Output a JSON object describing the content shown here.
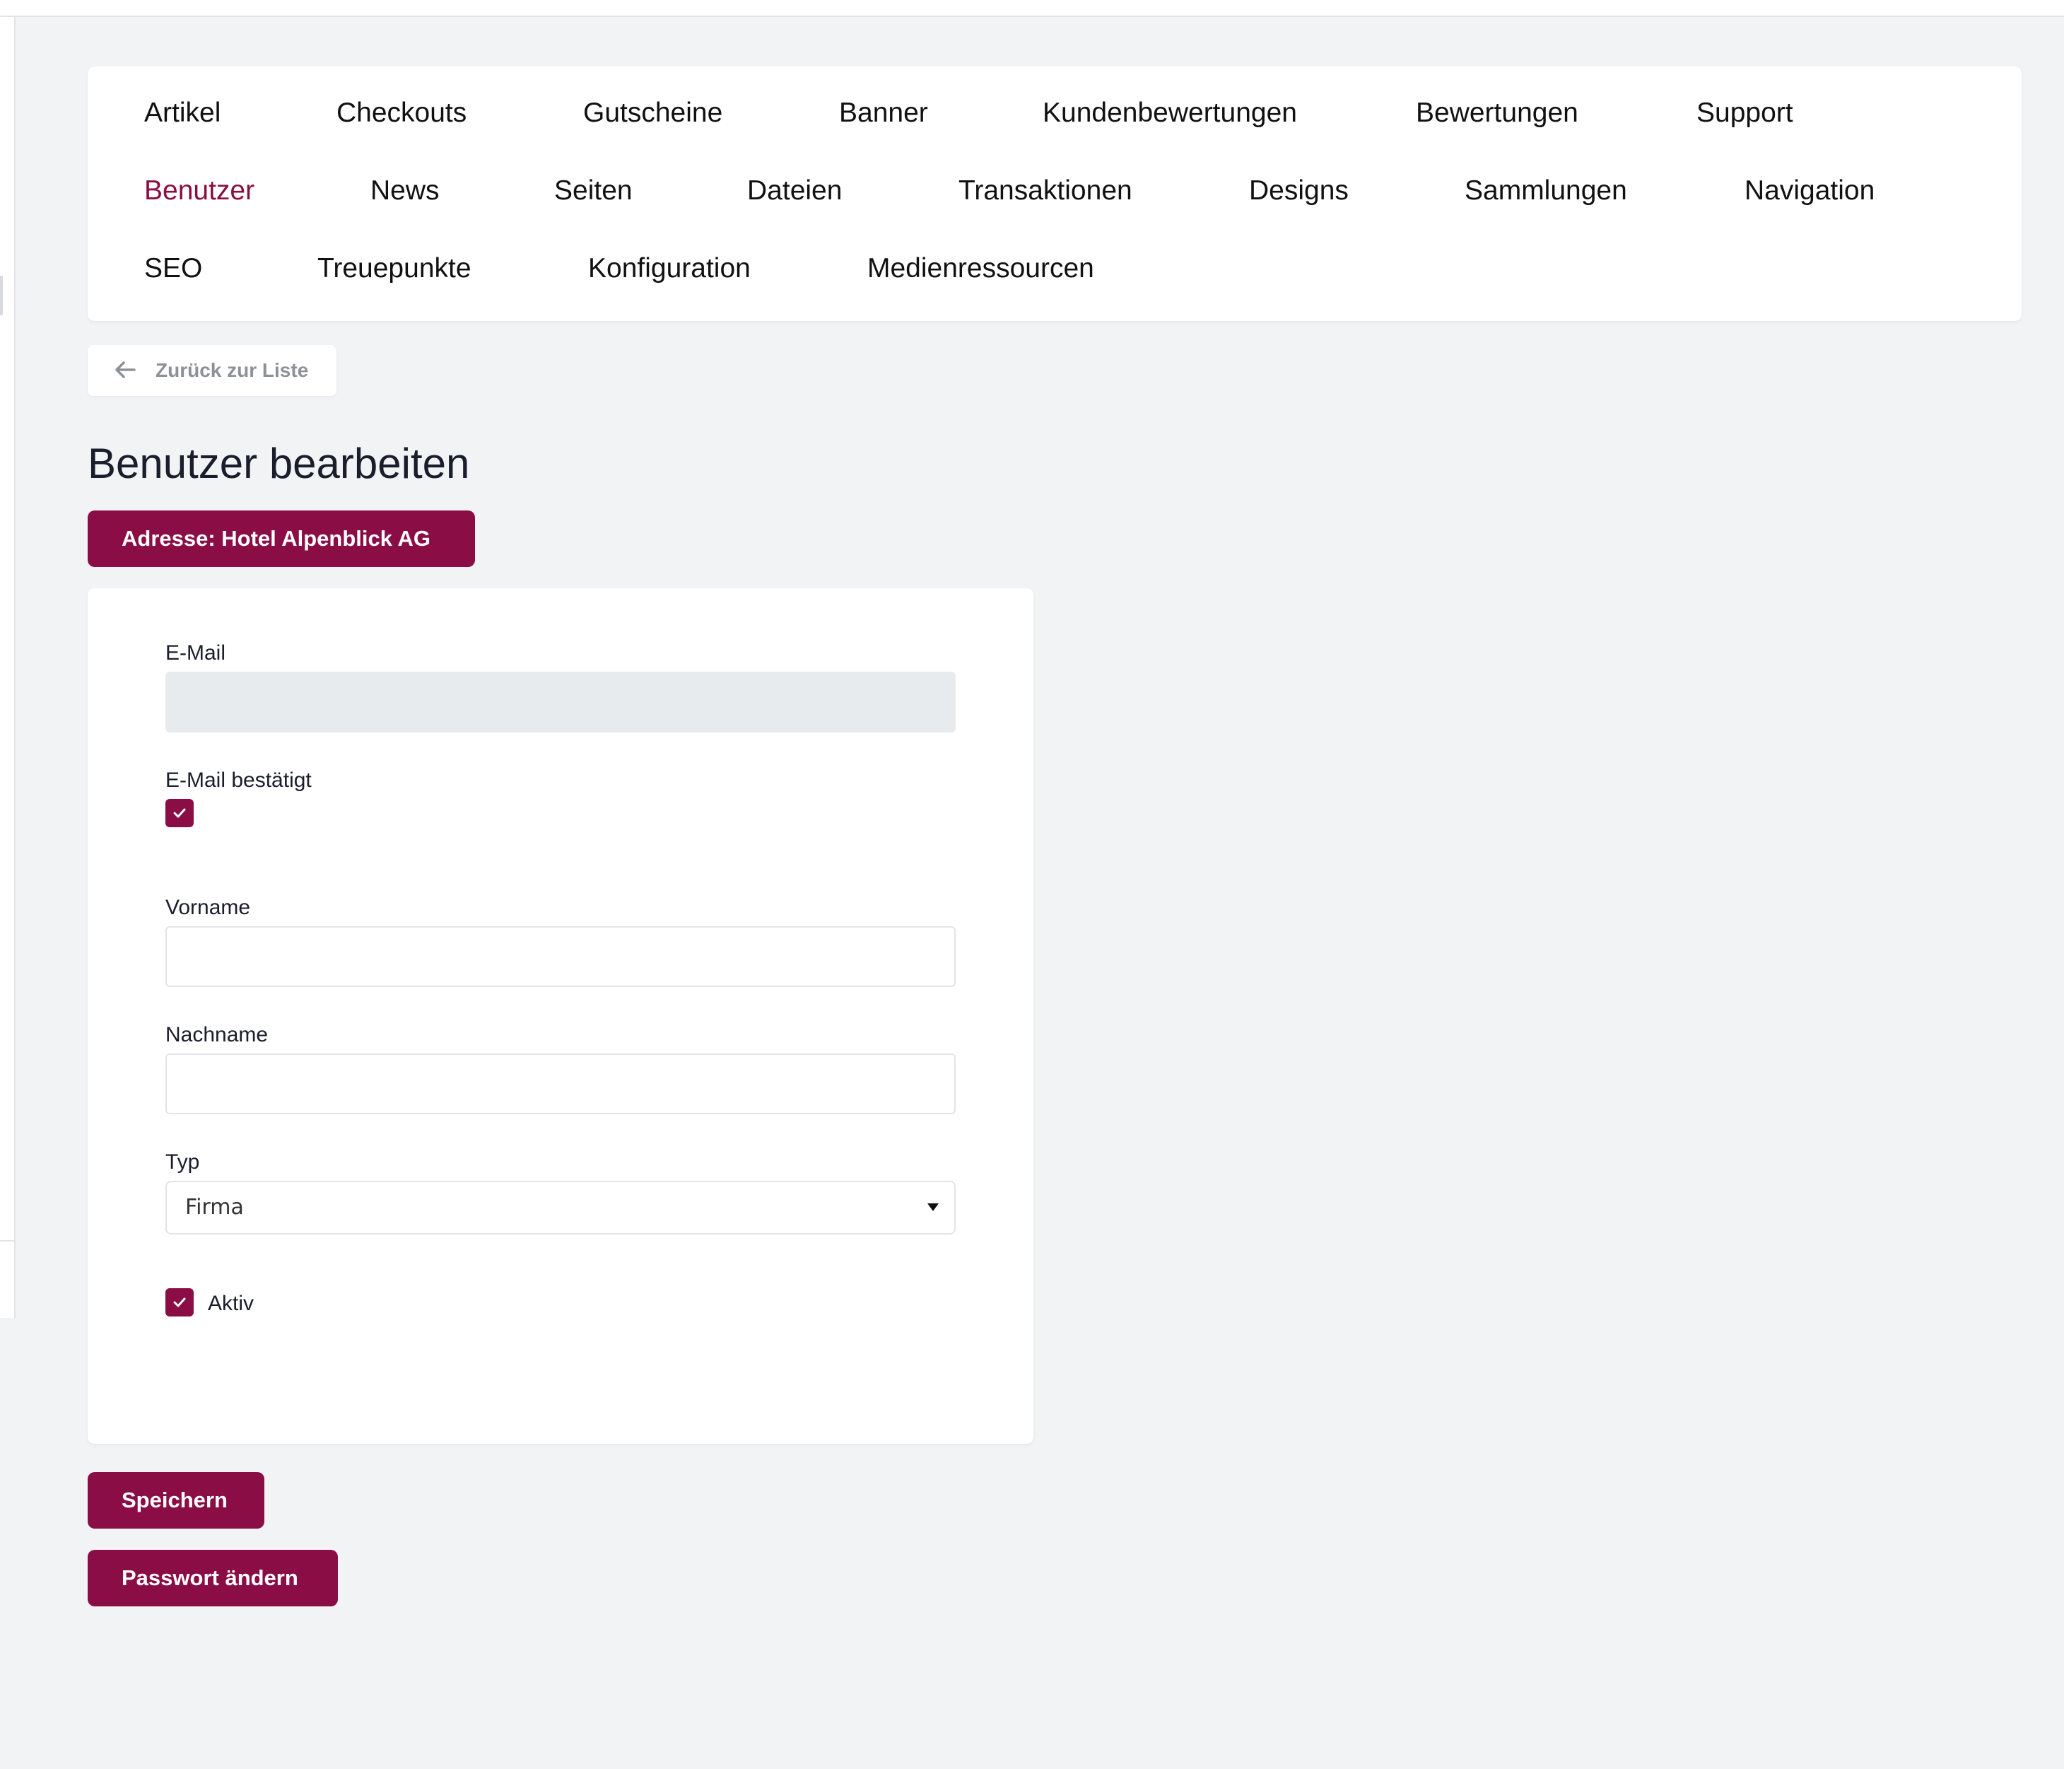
{
  "nav": {
    "items": [
      {
        "label": "Artikel",
        "active": false
      },
      {
        "label": "Checkouts",
        "active": false
      },
      {
        "label": "Gutscheine",
        "active": false
      },
      {
        "label": "Banner",
        "active": false
      },
      {
        "label": "Kundenbewertungen",
        "active": false
      },
      {
        "label": "Bewertungen",
        "active": false
      },
      {
        "label": "Support",
        "active": false
      },
      {
        "label": "Benutzer",
        "active": true
      },
      {
        "label": "News",
        "active": false
      },
      {
        "label": "Seiten",
        "active": false
      },
      {
        "label": "Dateien",
        "active": false
      },
      {
        "label": "Transaktionen",
        "active": false
      },
      {
        "label": "Designs",
        "active": false
      },
      {
        "label": "Sammlungen",
        "active": false
      },
      {
        "label": "Navigation",
        "active": false
      },
      {
        "label": "SEO",
        "active": false
      },
      {
        "label": "Treuepunkte",
        "active": false
      },
      {
        "label": "Konfiguration",
        "active": false
      },
      {
        "label": "Medienressourcen",
        "active": false
      }
    ]
  },
  "back_button": {
    "label": "Zurück zur Liste",
    "icon": "arrow-left-icon"
  },
  "page_title": "Benutzer bearbeiten",
  "address_button": {
    "label": "Adresse: Hotel Alpenblick AG"
  },
  "form": {
    "email": {
      "label": "E-Mail",
      "value": "",
      "disabled": true
    },
    "email_confirmed": {
      "label": "E-Mail bestätigt",
      "checked": true
    },
    "first_name": {
      "label": "Vorname",
      "value": ""
    },
    "last_name": {
      "label": "Nachname",
      "value": ""
    },
    "type": {
      "label": "Typ",
      "value": "Firma"
    },
    "active": {
      "label": "Aktiv",
      "checked": true
    }
  },
  "actions": {
    "save_label": "Speichern",
    "change_password_label": "Passwort ändern"
  },
  "colors": {
    "accent": "#8a0d45",
    "background": "#f2f3f5",
    "card": "#ffffff",
    "muted_text": "#8c9199"
  }
}
